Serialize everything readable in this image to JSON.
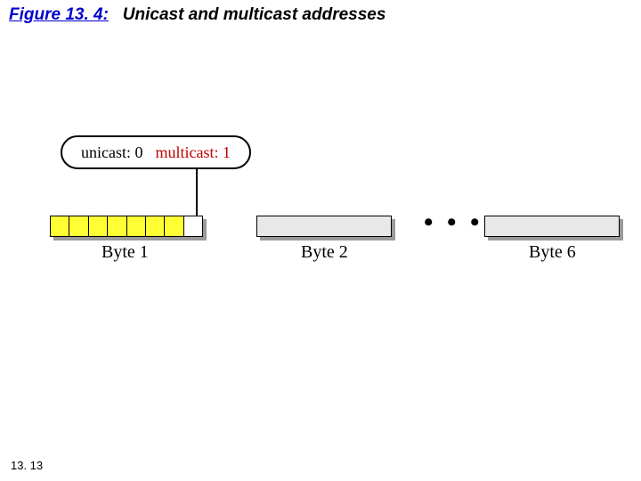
{
  "figure": {
    "number": "Figure 13. 4:",
    "caption": "Unicast and multicast addresses"
  },
  "bubble": {
    "unicast": "unicast: 0",
    "multicast": "multicast: 1"
  },
  "bytes": {
    "byte1": "Byte 1",
    "byte2": "Byte 2",
    "byte6": "Byte 6",
    "ellipsis": "• • •"
  },
  "page": "13. 13"
}
